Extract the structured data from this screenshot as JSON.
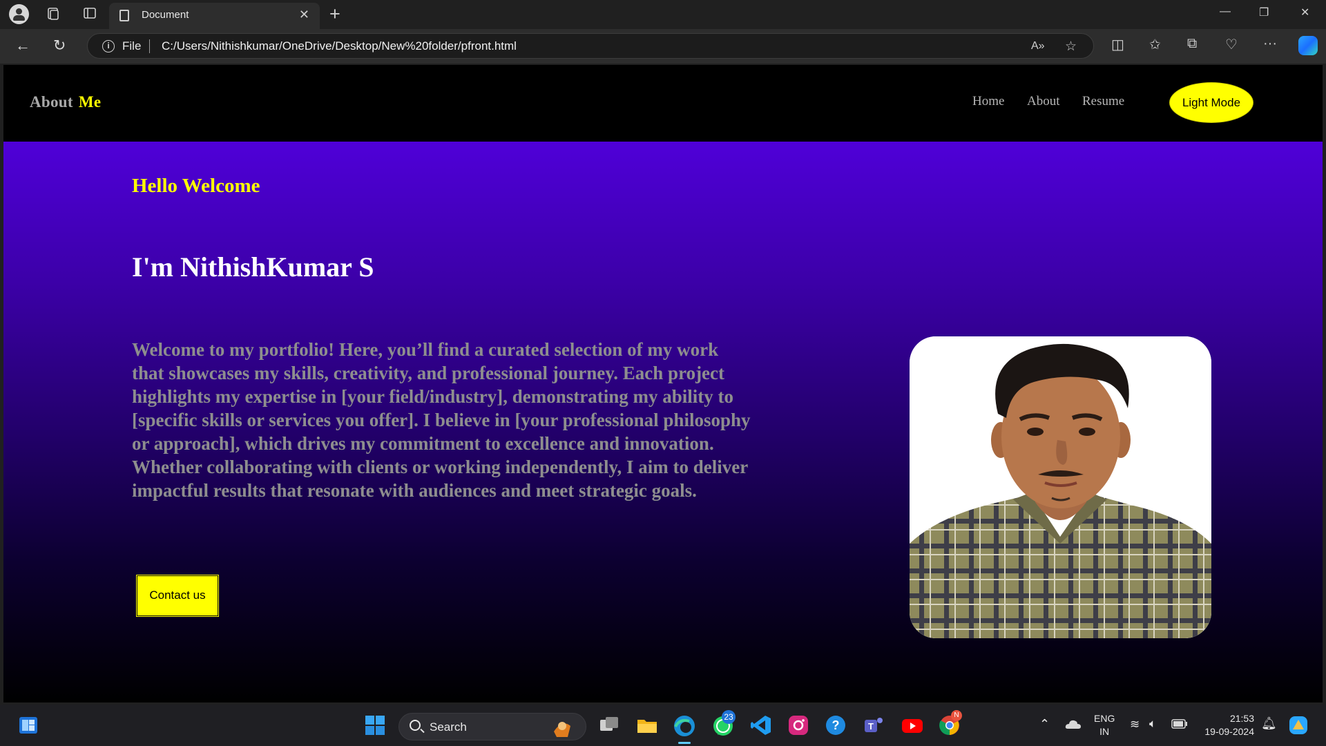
{
  "browser": {
    "tab_title": "Document",
    "address_scheme": "File",
    "url": "C:/Users/Nithishkumar/OneDrive/Desktop/New%20folder/pfront.html"
  },
  "site": {
    "logo_part1": "About",
    "logo_part2": "Me",
    "nav": [
      "Home",
      "About",
      "Resume"
    ],
    "mode_button": "Light Mode",
    "greeting": "Hello Welcome",
    "name": "I'm NithishKumar S",
    "intro": "Welcome to my portfolio! Here, you’ll find a curated selection of my work that showcases my skills, creativity, and professional journey. Each project highlights my expertise in [your field/industry], demonstrating my ability to [specific skills or services you offer]. I believe in [your professional philosophy or approach], which drives my commitment to excellence and innovation. Whether collaborating with clients or working independently, I aim to deliver impactful results that resonate with audiences and meet strategic goals.",
    "contact_button": "Contact us"
  },
  "taskbar": {
    "search_label": "Search",
    "whatsapp_badge": "23",
    "chrome_badge": "N",
    "lang_top": "ENG",
    "lang_bottom": "IN",
    "time": "21:53",
    "date": "19-09-2024"
  },
  "colors": {
    "accent_yellow": "#ffff00",
    "hero_top": "#4f00d8",
    "hero_bottom": "#000000"
  }
}
